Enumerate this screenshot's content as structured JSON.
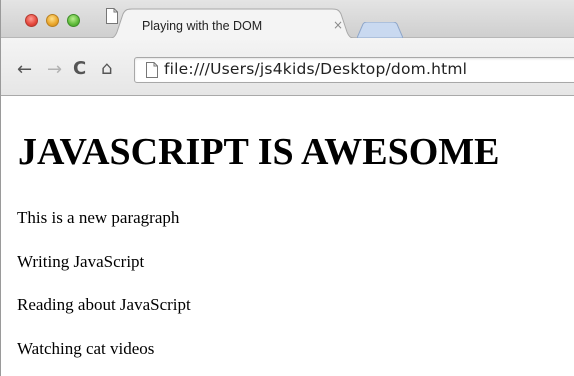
{
  "browser": {
    "tab_title": "Playing with the DOM",
    "tab_close_symbol": "×",
    "address_url": "file:///Users/js4kids/Desktop/dom.html",
    "icons": [
      "close-window-icon",
      "minimize-window-icon",
      "maximize-window-icon",
      "page-icon",
      "back-arrow-icon",
      "forward-arrow-icon",
      "reload-icon",
      "home-icon"
    ]
  },
  "page": {
    "heading": "JAVASCRIPT IS AWESOME",
    "paragraphs": [
      "This is a new paragraph",
      "Writing JavaScript",
      "Reading about JavaScript",
      "Watching cat videos"
    ]
  }
}
